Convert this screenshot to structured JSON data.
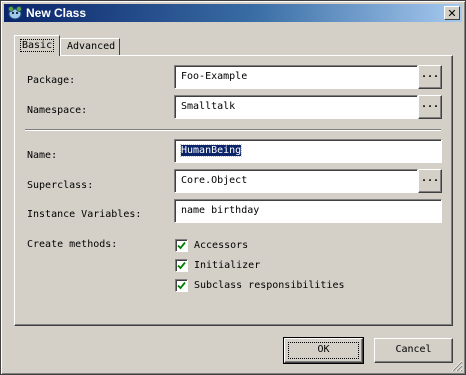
{
  "window": {
    "title": "New Class",
    "icon": "squeak-mouse-icon",
    "close_glyph": "✕"
  },
  "tabs": [
    {
      "label": "Basic",
      "active": true
    },
    {
      "label": "Advanced",
      "active": false
    }
  ],
  "form": {
    "package": {
      "label": "Package:",
      "value": "Foo-Example",
      "browse_label": "..."
    },
    "namespace": {
      "label": "Namespace:",
      "value": "Smalltalk",
      "browse_label": "..."
    },
    "name": {
      "label": "Name:",
      "value": "HumanBeing"
    },
    "superclass": {
      "label": "Superclass:",
      "value": "Core.Object",
      "browse_label": "..."
    },
    "instance_variables": {
      "label": "Instance Variables:",
      "value": "name birthday"
    },
    "create_methods": {
      "label": "Create methods:",
      "options": [
        {
          "label": "Accessors",
          "checked": true
        },
        {
          "label": "Initializer",
          "checked": true
        },
        {
          "label": "Subclass responsibilities",
          "checked": true
        }
      ]
    }
  },
  "buttons": {
    "ok_label": "OK",
    "cancel_label": "Cancel"
  },
  "colors": {
    "title_start": "#0a246a",
    "title_end": "#a6caf0",
    "face": "#d4d0c8",
    "check": "#008000"
  }
}
